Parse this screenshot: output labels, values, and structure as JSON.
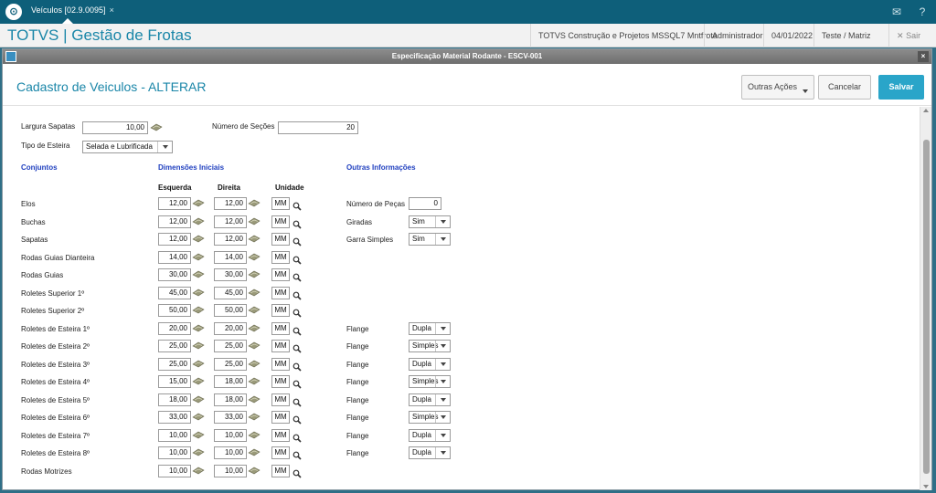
{
  "topbar": {
    "tab_label": "Veículos [02.9.0095]",
    "tab_close": "×",
    "icons": [
      "totvs-logo-icon",
      "mail-icon",
      "help-icon"
    ]
  },
  "appbar": {
    "title": "TOTVS | Gestão de Frotas",
    "company": "TOTVS Construção e Projetos MSSQL7 Mntfrota",
    "user": "Administrador",
    "date": "04/01/2022",
    "environment": "Teste / Matriz",
    "exit_label": "Sair",
    "exit_icon": "✕"
  },
  "dialog": {
    "title": "Especificação Material Rodante - ESCV-001",
    "close": "×",
    "header_title": "Cadastro de Veiculos - ALTERAR",
    "btn_outras": "Outras Ações",
    "btn_cancelar": "Cancelar",
    "btn_salvar": "Salvar"
  },
  "form": {
    "largura_label": "Largura Sapatas",
    "largura_value": "10,00",
    "secoes_label": "Número de Seções",
    "secoes_value": "20",
    "tipo_label": "Tipo de Esteira",
    "tipo_value": "Selada e Lubrificada",
    "sec_conjuntos": "Conjuntos",
    "sec_dimensoes": "Dimensões Iniciais",
    "sec_outras": "Outras Informações",
    "col_esquerda": "Esquerda",
    "col_direita": "Direita",
    "col_unidade": "Unidade"
  },
  "rows": [
    {
      "label": "Elos",
      "esq": "12,00",
      "dir": "12,00",
      "unit": "MM"
    },
    {
      "label": "Buchas",
      "esq": "12,00",
      "dir": "12,00",
      "unit": "MM"
    },
    {
      "label": "Sapatas",
      "esq": "12,00",
      "dir": "12,00",
      "unit": "MM"
    },
    {
      "label": "Rodas Guias Dianteira",
      "esq": "14,00",
      "dir": "14,00",
      "unit": "MM"
    },
    {
      "label": "Rodas Guias",
      "esq": "30,00",
      "dir": "30,00",
      "unit": "MM"
    },
    {
      "label": "Roletes Superior 1º",
      "esq": "45,00",
      "dir": "45,00",
      "unit": "MM"
    },
    {
      "label": "Roletes Superior 2º",
      "esq": "50,00",
      "dir": "50,00",
      "unit": "MM"
    },
    {
      "label": "Roletes de Esteira 1º",
      "esq": "20,00",
      "dir": "20,00",
      "unit": "MM"
    },
    {
      "label": "Roletes de Esteira 2º",
      "esq": "25,00",
      "dir": "25,00",
      "unit": "MM"
    },
    {
      "label": "Roletes de Esteira 3º",
      "esq": "25,00",
      "dir": "25,00",
      "unit": "MM"
    },
    {
      "label": "Roletes de Esteira 4º",
      "esq": "15,00",
      "dir": "18,00",
      "unit": "MM"
    },
    {
      "label": "Roletes de Esteira 5º",
      "esq": "18,00",
      "dir": "18,00",
      "unit": "MM"
    },
    {
      "label": "Roletes de Esteira 6º",
      "esq": "33,00",
      "dir": "33,00",
      "unit": "MM"
    },
    {
      "label": "Roletes de Esteira 7º",
      "esq": "10,00",
      "dir": "10,00",
      "unit": "MM"
    },
    {
      "label": "Roletes de Esteira 8º",
      "esq": "10,00",
      "dir": "10,00",
      "unit": "MM"
    },
    {
      "label": "Rodas Motrizes",
      "esq": "10,00",
      "dir": "10,00",
      "unit": "MM"
    }
  ],
  "other": [
    {
      "row": 0,
      "label": "Número de Peças",
      "kind": "num",
      "value": "0"
    },
    {
      "row": 1,
      "label": "Giradas",
      "kind": "sel",
      "value": "Sim"
    },
    {
      "row": 2,
      "label": "Garra Simples",
      "kind": "sel",
      "value": "Sim"
    },
    {
      "row": 7,
      "label": "Flange",
      "kind": "sel",
      "value": "Dupla"
    },
    {
      "row": 8,
      "label": "Flange",
      "kind": "sel",
      "value": "Simples"
    },
    {
      "row": 9,
      "label": "Flange",
      "kind": "sel",
      "value": "Dupla"
    },
    {
      "row": 10,
      "label": "Flange",
      "kind": "sel",
      "value": "Simples"
    },
    {
      "row": 11,
      "label": "Flange",
      "kind": "sel",
      "value": "Dupla"
    },
    {
      "row": 12,
      "label": "Flange",
      "kind": "sel",
      "value": "Simples"
    },
    {
      "row": 13,
      "label": "Flange",
      "kind": "sel",
      "value": "Dupla"
    },
    {
      "row": 14,
      "label": "Flange",
      "kind": "sel",
      "value": "Dupla"
    }
  ]
}
